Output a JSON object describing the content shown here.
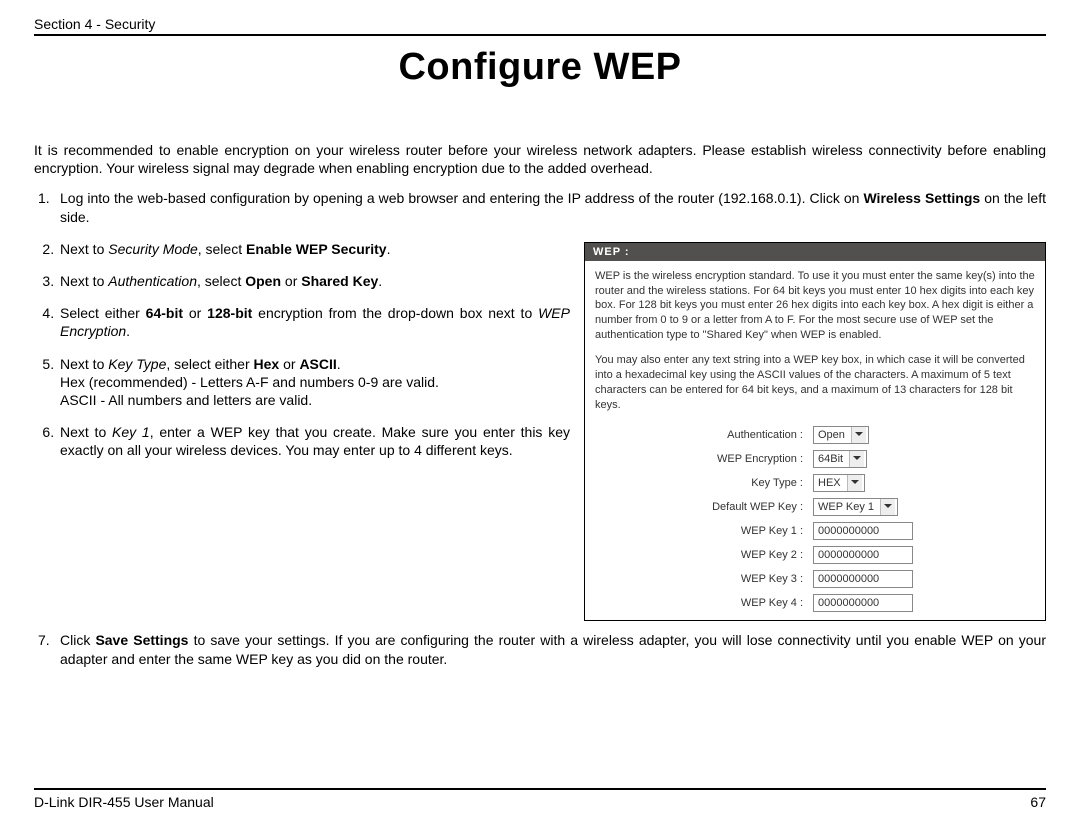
{
  "header": {
    "section": "Section 4 - Security"
  },
  "title": "Configure WEP",
  "intro": "It is recommended to enable encryption on your wireless router before your wireless network adapters. Please establish wireless connectivity before enabling encryption. Your wireless signal may degrade when enabling encryption due to the added overhead.",
  "step1": {
    "num": "1.",
    "prefix": "Log into the web-based configuration by opening a web browser and entering the IP address of the router (192.168.0.1).  Click on ",
    "bold": "Wireless Settings",
    "suffix": " on the left side."
  },
  "step2": {
    "prefix": "Next to ",
    "em": "Security Mode",
    "mid": ", select ",
    "bold": "Enable WEP Security",
    "suffix": "."
  },
  "step3": {
    "prefix": "Next to ",
    "em": "Authentication",
    "mid": ", select ",
    "bold1": "Open",
    "or": " or ",
    "bold2": "Shared Key",
    "suffix": "."
  },
  "step4": {
    "prefix": "Select either ",
    "bold1": "64-bit",
    "or": " or ",
    "bold2": "128-bit",
    "mid": " encryption from the drop-down box next to ",
    "em": "WEP Encryption",
    "suffix": "."
  },
  "step5": {
    "prefix": "Next to ",
    "em": "Key Type",
    "mid": ", select either ",
    "bold1": "Hex",
    "or": " or ",
    "bold2": "ASCII",
    "suffix": ".",
    "sub1": "Hex (recommended) - Letters A-F and numbers 0-9 are valid.",
    "sub2": "ASCII - All numbers and letters are valid."
  },
  "step6": {
    "prefix": "Next to ",
    "em": "Key 1",
    "suffix": ", enter a WEP key that you create. Make sure you enter this key exactly on all your wireless devices. You may enter up to 4 different keys."
  },
  "step7": {
    "num": "7.",
    "prefix": "Click ",
    "bold": "Save Settings",
    "suffix": " to save your settings. If you are configuring the router with a wireless adapter, you will lose connectivity until you enable WEP on your adapter and enter the same WEP key as you did on the router."
  },
  "wep_panel": {
    "title": "WEP :",
    "p1": "WEP is the wireless encryption standard. To use it you must enter the same key(s) into the router and the wireless stations. For 64 bit keys you must enter 10 hex digits into each key box. For 128 bit keys you must enter 26 hex digits into each key box. A hex digit is either a number from 0 to 9 or a letter from A to F. For the most secure use of WEP set the authentication type to \"Shared Key\" when WEP is enabled.",
    "p2": "You may also enter any text string into a WEP key box, in which case it will be converted into a hexadecimal key using the ASCII values of the characters. A maximum of 5 text characters can be entered for 64 bit keys, and a maximum of 13 characters for 128 bit keys.",
    "fields": {
      "auth_label": "Authentication :",
      "auth_value": "Open",
      "enc_label": "WEP Encryption :",
      "enc_value": "64Bit",
      "keytype_label": "Key Type :",
      "keytype_value": "HEX",
      "defkey_label": "Default WEP Key :",
      "defkey_value": "WEP Key 1",
      "k1_label": "WEP Key 1 :",
      "k1_value": "0000000000",
      "k2_label": "WEP Key 2 :",
      "k2_value": "0000000000",
      "k3_label": "WEP Key 3 :",
      "k3_value": "0000000000",
      "k4_label": "WEP Key 4 :",
      "k4_value": "0000000000"
    }
  },
  "footer": {
    "left": "D-Link DIR-455 User Manual",
    "right": "67"
  }
}
